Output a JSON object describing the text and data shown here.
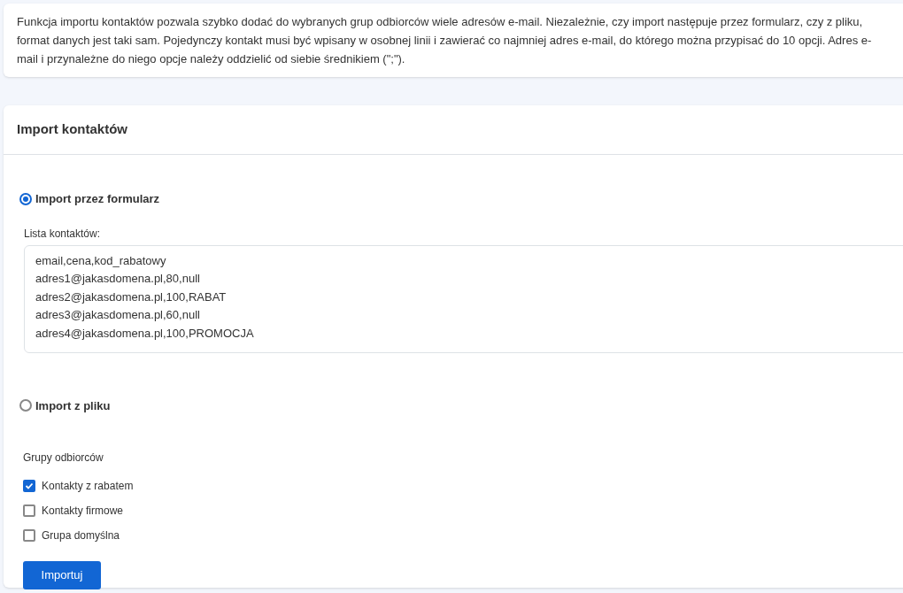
{
  "intro": "Funkcja importu kontaktów pozwala szybko dodać do wybranych grup odbiorców wiele adresów e-mail. Niezależnie, czy import następuje przez formularz, czy z pliku, format danych jest taki sam. Pojedynczy kontakt musi być wpisany w osobnej linii i zawierać co najmniej adres e-mail, do którego można przypisać do 10 opcji. Adres e-mail i przynależne do niego opcje należy oddzielić od siebie średnikiem (\";\").",
  "card": {
    "title": "Import kontaktów",
    "import_options": [
      {
        "label": "Import przez formularz",
        "selected": true,
        "field_label": "Lista kontaktów:",
        "field_lines": [
          "email,cena,kod_rabatowy",
          "adres1@jakasdomena.pl,80,null",
          "adres2@jakasdomena.pl,100,RABAT",
          "adres3@jakasdomena.pl,60,null",
          "adres4@jakasdomena.pl,100,PROMOCJA"
        ]
      },
      {
        "label": "Import z pliku",
        "selected": false
      }
    ],
    "groups_label": "Grupy odbiorców",
    "groups": [
      {
        "label": "Kontakty z rabatem",
        "checked": true
      },
      {
        "label": "Kontakty firmowe",
        "checked": false
      },
      {
        "label": "Grupa domyślna",
        "checked": false
      }
    ],
    "button": "Importuj"
  }
}
